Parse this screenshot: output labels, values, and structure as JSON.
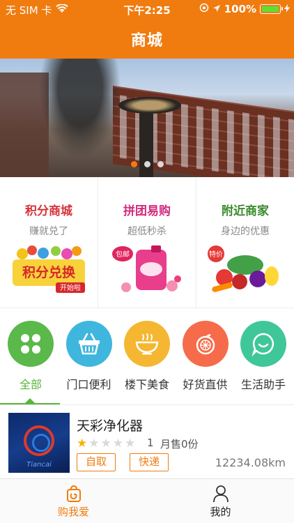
{
  "status_bar": {
    "carrier": "无 SIM 卡",
    "time": "下午2:25",
    "battery_percent": "100%"
  },
  "nav": {
    "title": "商城"
  },
  "banner": {
    "page_count": 3,
    "active_index": 0
  },
  "promos": [
    {
      "title": "积分商城",
      "subtitle": "赚就兑了",
      "title_color": "#d8333a",
      "art_text": "积分兑换",
      "art_subtext": "开始啦"
    },
    {
      "title": "拼团易购",
      "subtitle": "超低秒杀",
      "title_color": "#d32a7e",
      "badge": "包邮"
    },
    {
      "title": "附近商家",
      "subtitle": "身边的优惠",
      "title_color": "#3a8a2c",
      "badge": "特价"
    }
  ],
  "categories": [
    {
      "label": "全部",
      "icon": "clover-icon",
      "color": "#5bb84a",
      "active": true
    },
    {
      "label": "门口便利",
      "icon": "basket-icon",
      "color": "#3fb6de",
      "active": false
    },
    {
      "label": "楼下美食",
      "icon": "bowl-icon",
      "color": "#f5b631",
      "active": false
    },
    {
      "label": "好货直供",
      "icon": "orange-icon",
      "color": "#f66b4a",
      "active": false
    },
    {
      "label": "生活助手",
      "icon": "chat-icon",
      "color": "#3fc79a",
      "active": false
    }
  ],
  "product": {
    "name": "天彩净化器",
    "stars": 1,
    "max_stars": 5,
    "rating": "1",
    "sales": "月售0份",
    "tags": [
      "自取",
      "快递"
    ],
    "distance": "12234.08km",
    "thumb_text": "Tiancai"
  },
  "tabbar": [
    {
      "label": "购我爱",
      "icon": "shop-bag-icon",
      "active": true
    },
    {
      "label": "我的",
      "icon": "person-icon",
      "active": false
    }
  ],
  "colors": {
    "brand": "#f07c10",
    "active_green": "#59b53a"
  }
}
